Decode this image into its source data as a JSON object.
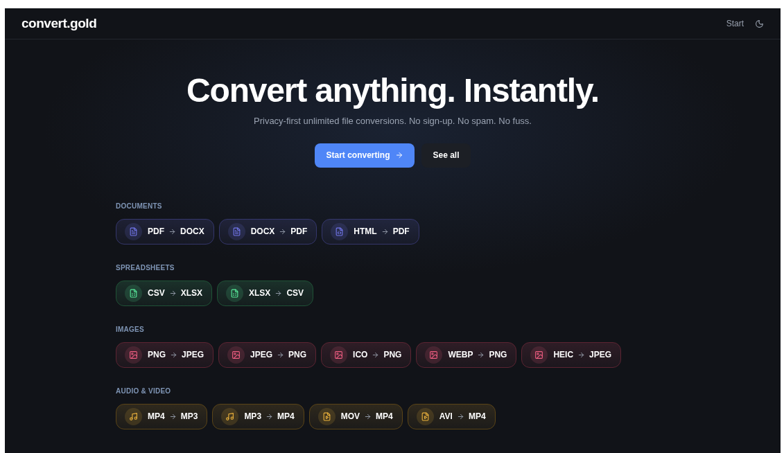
{
  "header": {
    "logo": "convert.gold",
    "nav_link": "Start"
  },
  "hero": {
    "title": "Convert anything. Instantly.",
    "subtitle": "Privacy-first unlimited file conversions. No sign-up. No spam. No fuss.",
    "primary_button": "Start converting",
    "secondary_button": "See all"
  },
  "categories": [
    {
      "label": "DOCUMENTS",
      "color": "#34366b",
      "conversions": [
        {
          "from": "PDF",
          "to": "DOCX",
          "kind": "document"
        },
        {
          "from": "DOCX",
          "to": "PDF",
          "kind": "document"
        },
        {
          "from": "HTML",
          "to": "PDF",
          "kind": "code"
        }
      ]
    },
    {
      "label": "SPREADSHEETS",
      "color": "#1f5236",
      "conversions": [
        {
          "from": "CSV",
          "to": "XLSX",
          "kind": "sheet"
        },
        {
          "from": "XLSX",
          "to": "CSV",
          "kind": "sheet"
        }
      ]
    },
    {
      "label": "IMAGES",
      "color": "#5c2432",
      "conversions": [
        {
          "from": "PNG",
          "to": "JPEG",
          "kind": "image"
        },
        {
          "from": "JPEG",
          "to": "PNG",
          "kind": "image"
        },
        {
          "from": "ICO",
          "to": "PNG",
          "kind": "image"
        },
        {
          "from": "WEBP",
          "to": "PNG",
          "kind": "image"
        },
        {
          "from": "HEIC",
          "to": "JPEG",
          "kind": "image"
        }
      ]
    },
    {
      "label": "AUDIO & VIDEO",
      "color": "#5a4417",
      "conversions": [
        {
          "from": "MP4",
          "to": "MP3",
          "kind": "audio"
        },
        {
          "from": "MP3",
          "to": "MP4",
          "kind": "audio"
        },
        {
          "from": "MOV",
          "to": "MP4",
          "kind": "video"
        },
        {
          "from": "AVI",
          "to": "MP4",
          "kind": "video"
        }
      ]
    }
  ]
}
